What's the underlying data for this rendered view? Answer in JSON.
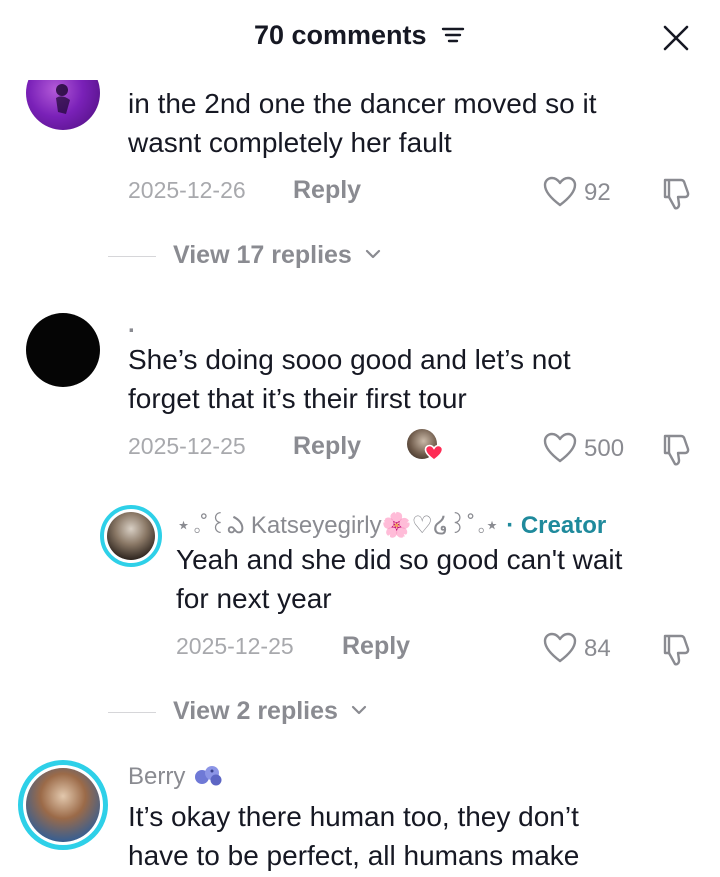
{
  "header": {
    "title": "70 comments"
  },
  "comments": [
    {
      "text_line1": "in the 2nd one the dancer moved so it",
      "text_line2": "wasnt completely her fault",
      "date": "2025-12-26",
      "reply_label": "Reply",
      "likes": "92",
      "view_replies": "View 17 replies"
    },
    {
      "username": ".",
      "text_line1": "She’s doing sooo good and let’s not",
      "text_line2": "forget that it’s their first tour",
      "date": "2025-12-25",
      "reply_label": "Reply",
      "likes": "500",
      "reply": {
        "username": "⋆｡˚꒰ఎ Katseyegirly🌸♡໒꒱˚｡⋆",
        "creator_label": "· Creator",
        "text_line1": "Yeah and she did so good can't wait",
        "text_line2": "for next year",
        "date": "2025-12-25",
        "reply_label": "Reply",
        "likes": "84"
      },
      "view_replies": "View 2 replies"
    },
    {
      "username": "Berry",
      "text_line1": "It’s okay there human too, they don’t",
      "text_line2": "have to be perfect, all humans make"
    }
  ],
  "colors": {
    "accent_creator": "#1f8a9c",
    "story_ring": "#2ed0e8",
    "heart_badge": "#fe2c55"
  },
  "icons": [
    "filter-icon",
    "close-icon",
    "heart-icon",
    "dislike-icon",
    "chevron-down-icon",
    "berries-emoji-icon"
  ]
}
